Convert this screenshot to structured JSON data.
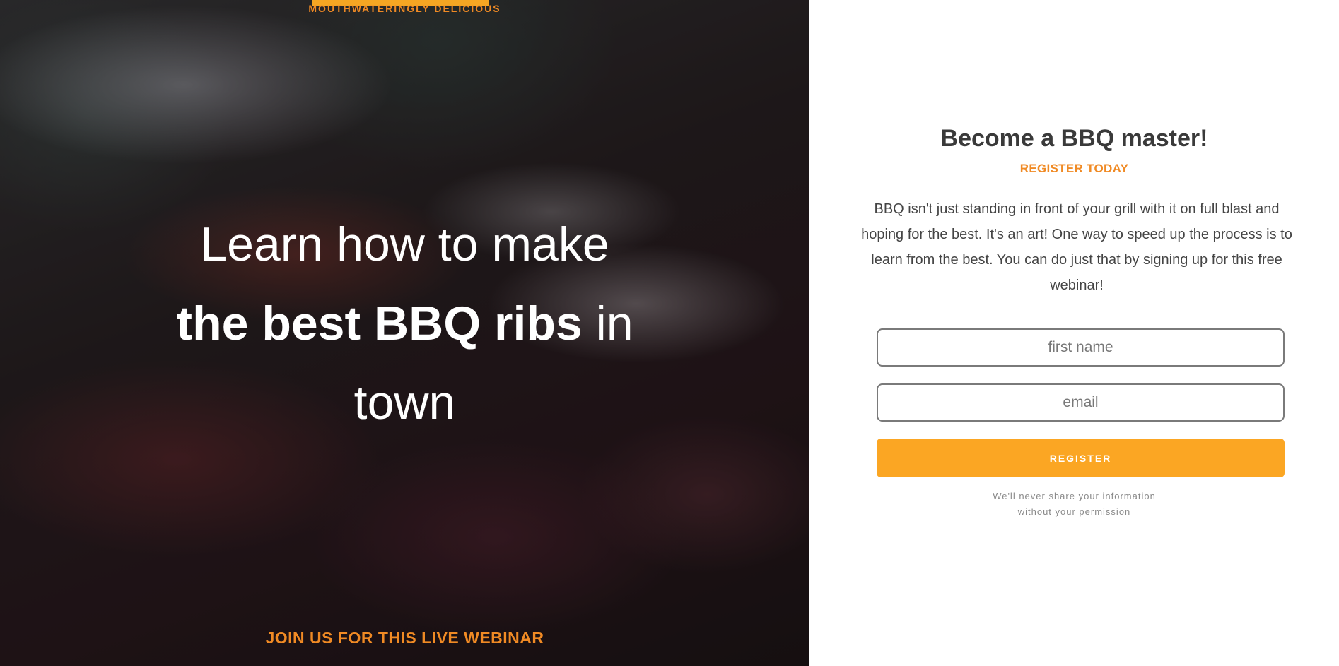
{
  "hero": {
    "eyebrow": "MOUTHWATERINGLY DELICIOUS",
    "headline_line1": "Learn how to make",
    "headline_bold": "the best BBQ ribs",
    "headline_tail": " in town",
    "webinar_label": "JOIN US FOR THIS LIVE WEBINAR"
  },
  "panel": {
    "title": "Become a BBQ master!",
    "subtitle": "REGISTER TODAY",
    "body": "BBQ isn't just standing in front of your grill with it on full blast and hoping for the best. It's an art! One way to speed up the process is to learn from the best. You can do just that by signing up for this free webinar!",
    "form": {
      "first_name_placeholder": "first name",
      "email_placeholder": "email",
      "register_label": "REGISTER"
    },
    "privacy_line1": "We'll never share your information",
    "privacy_line2": "without your permission"
  },
  "colors": {
    "accent_orange": "#f08a24",
    "button_orange": "#fba623",
    "heading_text": "#3a3a3a"
  }
}
